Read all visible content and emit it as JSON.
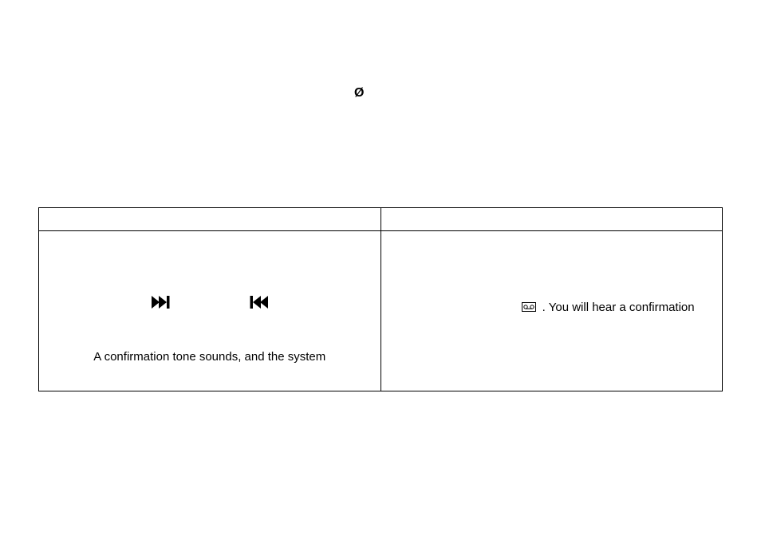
{
  "glyph": "Ø",
  "table": {
    "left": {
      "icon_forward": "forward-end-icon",
      "icon_back": "backward-start-icon",
      "text": "A confirmation tone sounds, and the system"
    },
    "right": {
      "icon_mail": "voicemail-icon",
      "text": ". You will hear a confirmation"
    }
  }
}
